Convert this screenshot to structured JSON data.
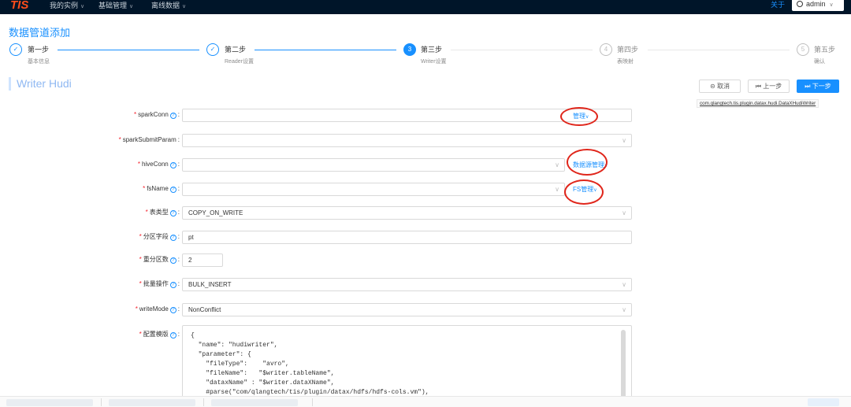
{
  "topbar": {
    "logo_text": "TIS",
    "nav": [
      {
        "label": "我的实例"
      },
      {
        "label": "基础管理"
      },
      {
        "label": "离线数据"
      }
    ],
    "about": "关于",
    "user": "admin"
  },
  "page": {
    "title": "数据管道添加"
  },
  "steps": [
    {
      "num": "✓",
      "title": "第一步",
      "desc": "基本信息",
      "status": "done"
    },
    {
      "num": "✓",
      "title": "第二步",
      "desc": "Reader设置",
      "status": "done"
    },
    {
      "num": "3",
      "title": "第三步",
      "desc": "Writer设置",
      "status": "active"
    },
    {
      "num": "4",
      "title": "第四步",
      "desc": "表映射",
      "status": "wait"
    },
    {
      "num": "5",
      "title": "第五步",
      "desc": "确认",
      "status": "wait"
    }
  ],
  "section": {
    "title": "Writer Hudi"
  },
  "actions": {
    "cancel": "取消",
    "prev": "上一步",
    "next": "下一步",
    "plugin_class": "com.qlangtech.tis.plugin.datax.hudi.DataXHudiWriter"
  },
  "form": {
    "sparkConn": {
      "label": "sparkConn",
      "value": "",
      "manage": "管理"
    },
    "sparkSubmitParam": {
      "label": "sparkSubmitParam",
      "value": ""
    },
    "hiveConn": {
      "label": "hiveConn",
      "value": "",
      "manage": "数据源管理"
    },
    "fsName": {
      "label": "fsName",
      "value": "",
      "manage": "FS管理"
    },
    "tableType": {
      "label": "表类型",
      "value": "COPY_ON_WRITE"
    },
    "partitionField": {
      "label": "分区字段",
      "value": "pt"
    },
    "shuffleParallelism": {
      "label": "重分区数",
      "value": "2"
    },
    "batchOp": {
      "label": "批量操作",
      "value": "BULK_INSERT"
    },
    "writeMode": {
      "label": "writeMode",
      "value": "NonConflict"
    },
    "template": {
      "label": "配置模版",
      "lines": [
        "{",
        "  \"name\": \"hudiwriter\",",
        "  \"parameter\": {",
        "    \"fileType\":    \"avro\",",
        "    \"fileName\":   \"$writer.tableName\",",
        "    \"dataxName\" : \"$writer.dataXName\",",
        "    #parse(\"com/qlangtech/tis/plugin/datax/hdfs/hdfs-cols.vm\"),"
      ]
    }
  }
}
